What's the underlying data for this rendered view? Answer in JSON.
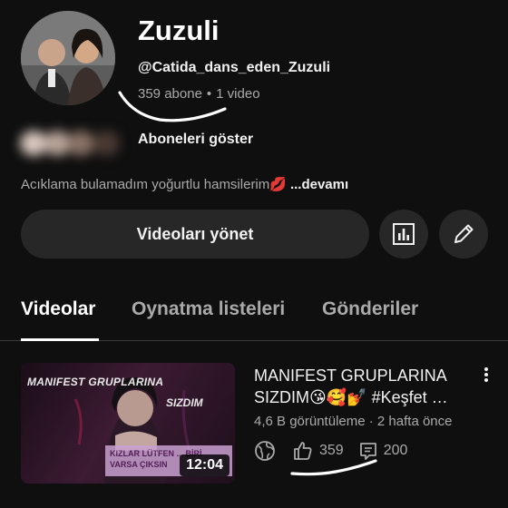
{
  "channel": {
    "name": "Zuzuli",
    "handle": "@Catida_dans_eden_Zuzuli",
    "subscribers": "359 abone",
    "separator": "•",
    "video_count": "1 video",
    "show_subscribers": "Aboneleri göster",
    "description": "Acıklama bulamadım yoğurtlu hamsilerim💋",
    "more": "...devamı"
  },
  "actions": {
    "manage_videos": "Videoları yönet",
    "analytics_icon": "bar-chart-icon",
    "edit_icon": "pencil-icon"
  },
  "tabs": [
    {
      "label": "Videolar",
      "active": true
    },
    {
      "label": "Oynatma listeleri",
      "active": false
    },
    {
      "label": "Gönderiler",
      "active": false
    }
  ],
  "video": {
    "title_line1": "MANIFEST GRUPLARINA",
    "title_line2": "SIZDIM😘🥰💅 #Keşfet …",
    "views": "4,6 B görüntüleme",
    "meta_separator": "·",
    "age": "2 hafta önce",
    "likes": "359",
    "comments": "200",
    "duration": "12:04",
    "thumbnail_text_top": "MANIFEST GRUPLARINA",
    "thumbnail_text_sub": "SIZDIM",
    "thumbnail_text_box": "KIZLAR LÜTFEN ... BİRİ VARSA ÇIKSIN",
    "visibility_icon": "globe-icon"
  },
  "colors": {
    "background": "#0f0f0f",
    "button_bg": "#272727",
    "text_primary": "#f1f1f1",
    "text_secondary": "#aaaaaa",
    "annotation": "#ffffff"
  }
}
